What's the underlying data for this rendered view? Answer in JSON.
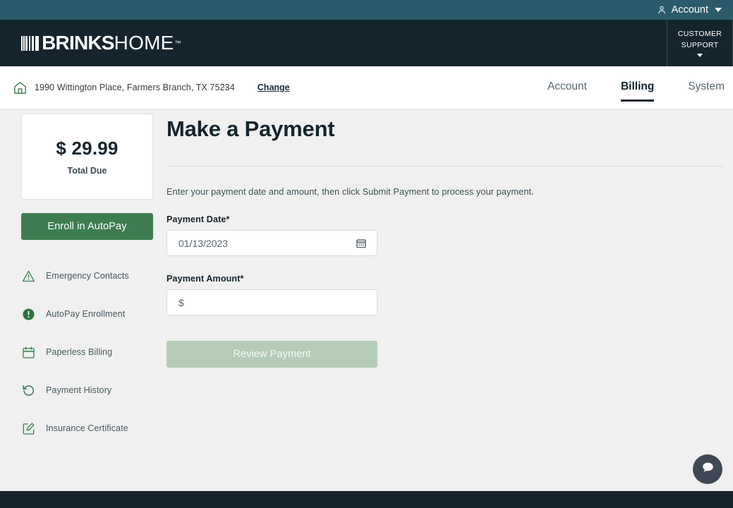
{
  "topbar": {
    "account_label": "Account",
    "person_icon": "person-icon",
    "caret_icon": "chevron-down-icon"
  },
  "header": {
    "logo_brinks": "BRINKS",
    "logo_home": "HOME",
    "logo_tm": "™",
    "support_line1": "CUSTOMER",
    "support_line2": "SUPPORT"
  },
  "subnav": {
    "home_icon": "home-icon",
    "address": "1990 Wittington Place, Farmers Branch, TX 75234",
    "change_label": "Change",
    "tabs": [
      {
        "label": "Account",
        "active": false
      },
      {
        "label": "Billing",
        "active": true
      },
      {
        "label": "System",
        "active": false
      }
    ]
  },
  "sidebar": {
    "due_amount": "$ 29.99",
    "due_label": "Total Due",
    "autopay_button": "Enroll in AutoPay",
    "items": [
      {
        "label": "Emergency Contacts",
        "icon": "warning-triangle-icon"
      },
      {
        "label": "AutoPay Enrollment",
        "icon": "exclamation-circle-icon"
      },
      {
        "label": "Paperless Billing",
        "icon": "calendar-icon"
      },
      {
        "label": "Payment History",
        "icon": "history-undo-icon"
      },
      {
        "label": "Insurance Certificate",
        "icon": "edit-square-icon"
      }
    ]
  },
  "main": {
    "title": "Make a Payment",
    "intro": "Enter your payment date and amount, then click Submit Payment to process your payment.",
    "payment_date_label": "Payment Date*",
    "payment_date_value": "01/13/2023",
    "calendar_icon": "calendar-icon",
    "payment_amount_label": "Payment Amount*",
    "payment_amount_placeholder": "$",
    "payment_amount_value": "",
    "review_button": "Review Payment"
  },
  "chat": {
    "icon": "chat-bubble-icon"
  },
  "colors": {
    "topbar_teal": "#2b5b6b",
    "header_dark": "#16252d",
    "page_bg": "#eff0ef",
    "accent_green": "#3e7d51",
    "disabled_green": "#b6ccb8",
    "icon_green": "#3e7d51",
    "chat_gray": "#3f4854"
  }
}
